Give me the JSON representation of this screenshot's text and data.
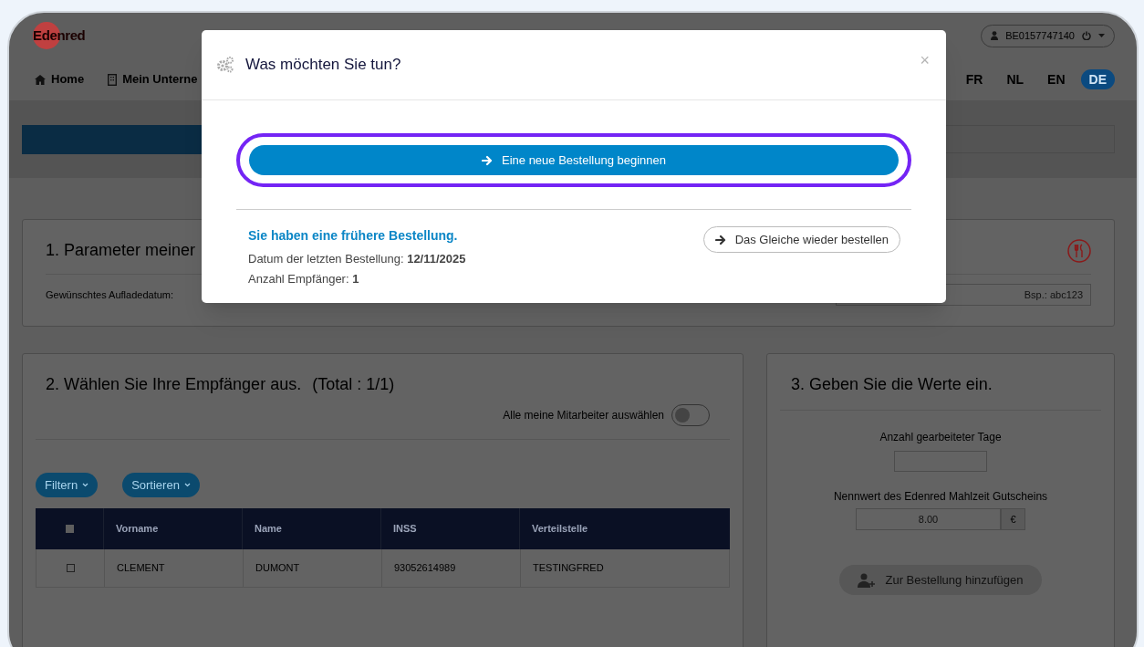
{
  "header": {
    "logo": "Edenred",
    "account_id": "BE0157747140"
  },
  "nav": [
    {
      "label": "Home",
      "kind": "home"
    },
    {
      "label": "Mein Unterne",
      "kind": "company"
    }
  ],
  "languages": [
    {
      "label": "FR",
      "selected": false
    },
    {
      "label": "NL",
      "selected": false
    },
    {
      "label": "EN",
      "selected": false
    },
    {
      "label": "DE",
      "selected": true
    }
  ],
  "section1": {
    "title": "1. Parameter meiner",
    "date_label": "Gewünschtes Aufladedatum:",
    "reference_placeholder": "Bsp.: abc123"
  },
  "section2": {
    "title": "2. Wählen Sie Ihre Empfänger aus.",
    "total": "(Total : 1/1)",
    "toggle": {
      "label": "Alle meine Mitarbeiter auswählen",
      "on": false
    },
    "buttons": [
      "Filtern",
      "Sortieren"
    ],
    "table": {
      "header_checked": false,
      "columns": [
        "Vorname",
        "Name",
        "INSS",
        "Verteilstelle"
      ],
      "rows": [
        {
          "checked": false,
          "cells": [
            "CLEMENT",
            "DUMONT",
            "93052614989",
            "TESTINGFRED"
          ]
        }
      ]
    }
  },
  "section3": {
    "title": "3. Geben Sie die Werte ein.",
    "days_label": "Anzahl gearbeiteter Tage",
    "value_label": "Nennwert des Edenred Mahlzeit Gutscheins",
    "value_placeholder": "8.00",
    "currency": "€",
    "add_button": {
      "label": "Zur Bestellung hinzufügen",
      "disabled": true
    }
  },
  "modal": {
    "title": "Was möchten Sie tun?",
    "close": "×",
    "primary_button": {
      "label": "Eine neue Bestellung beginnen",
      "highlighted": true
    },
    "previous_heading": "Sie haben eine frühere Bestellung.",
    "last_order": "Datum der letzten Bestellung: **12/11/2025**",
    "recipients": "Anzahl Empfänger: **1**",
    "repeat_button": "Das Gleiche wieder bestellen"
  }
}
